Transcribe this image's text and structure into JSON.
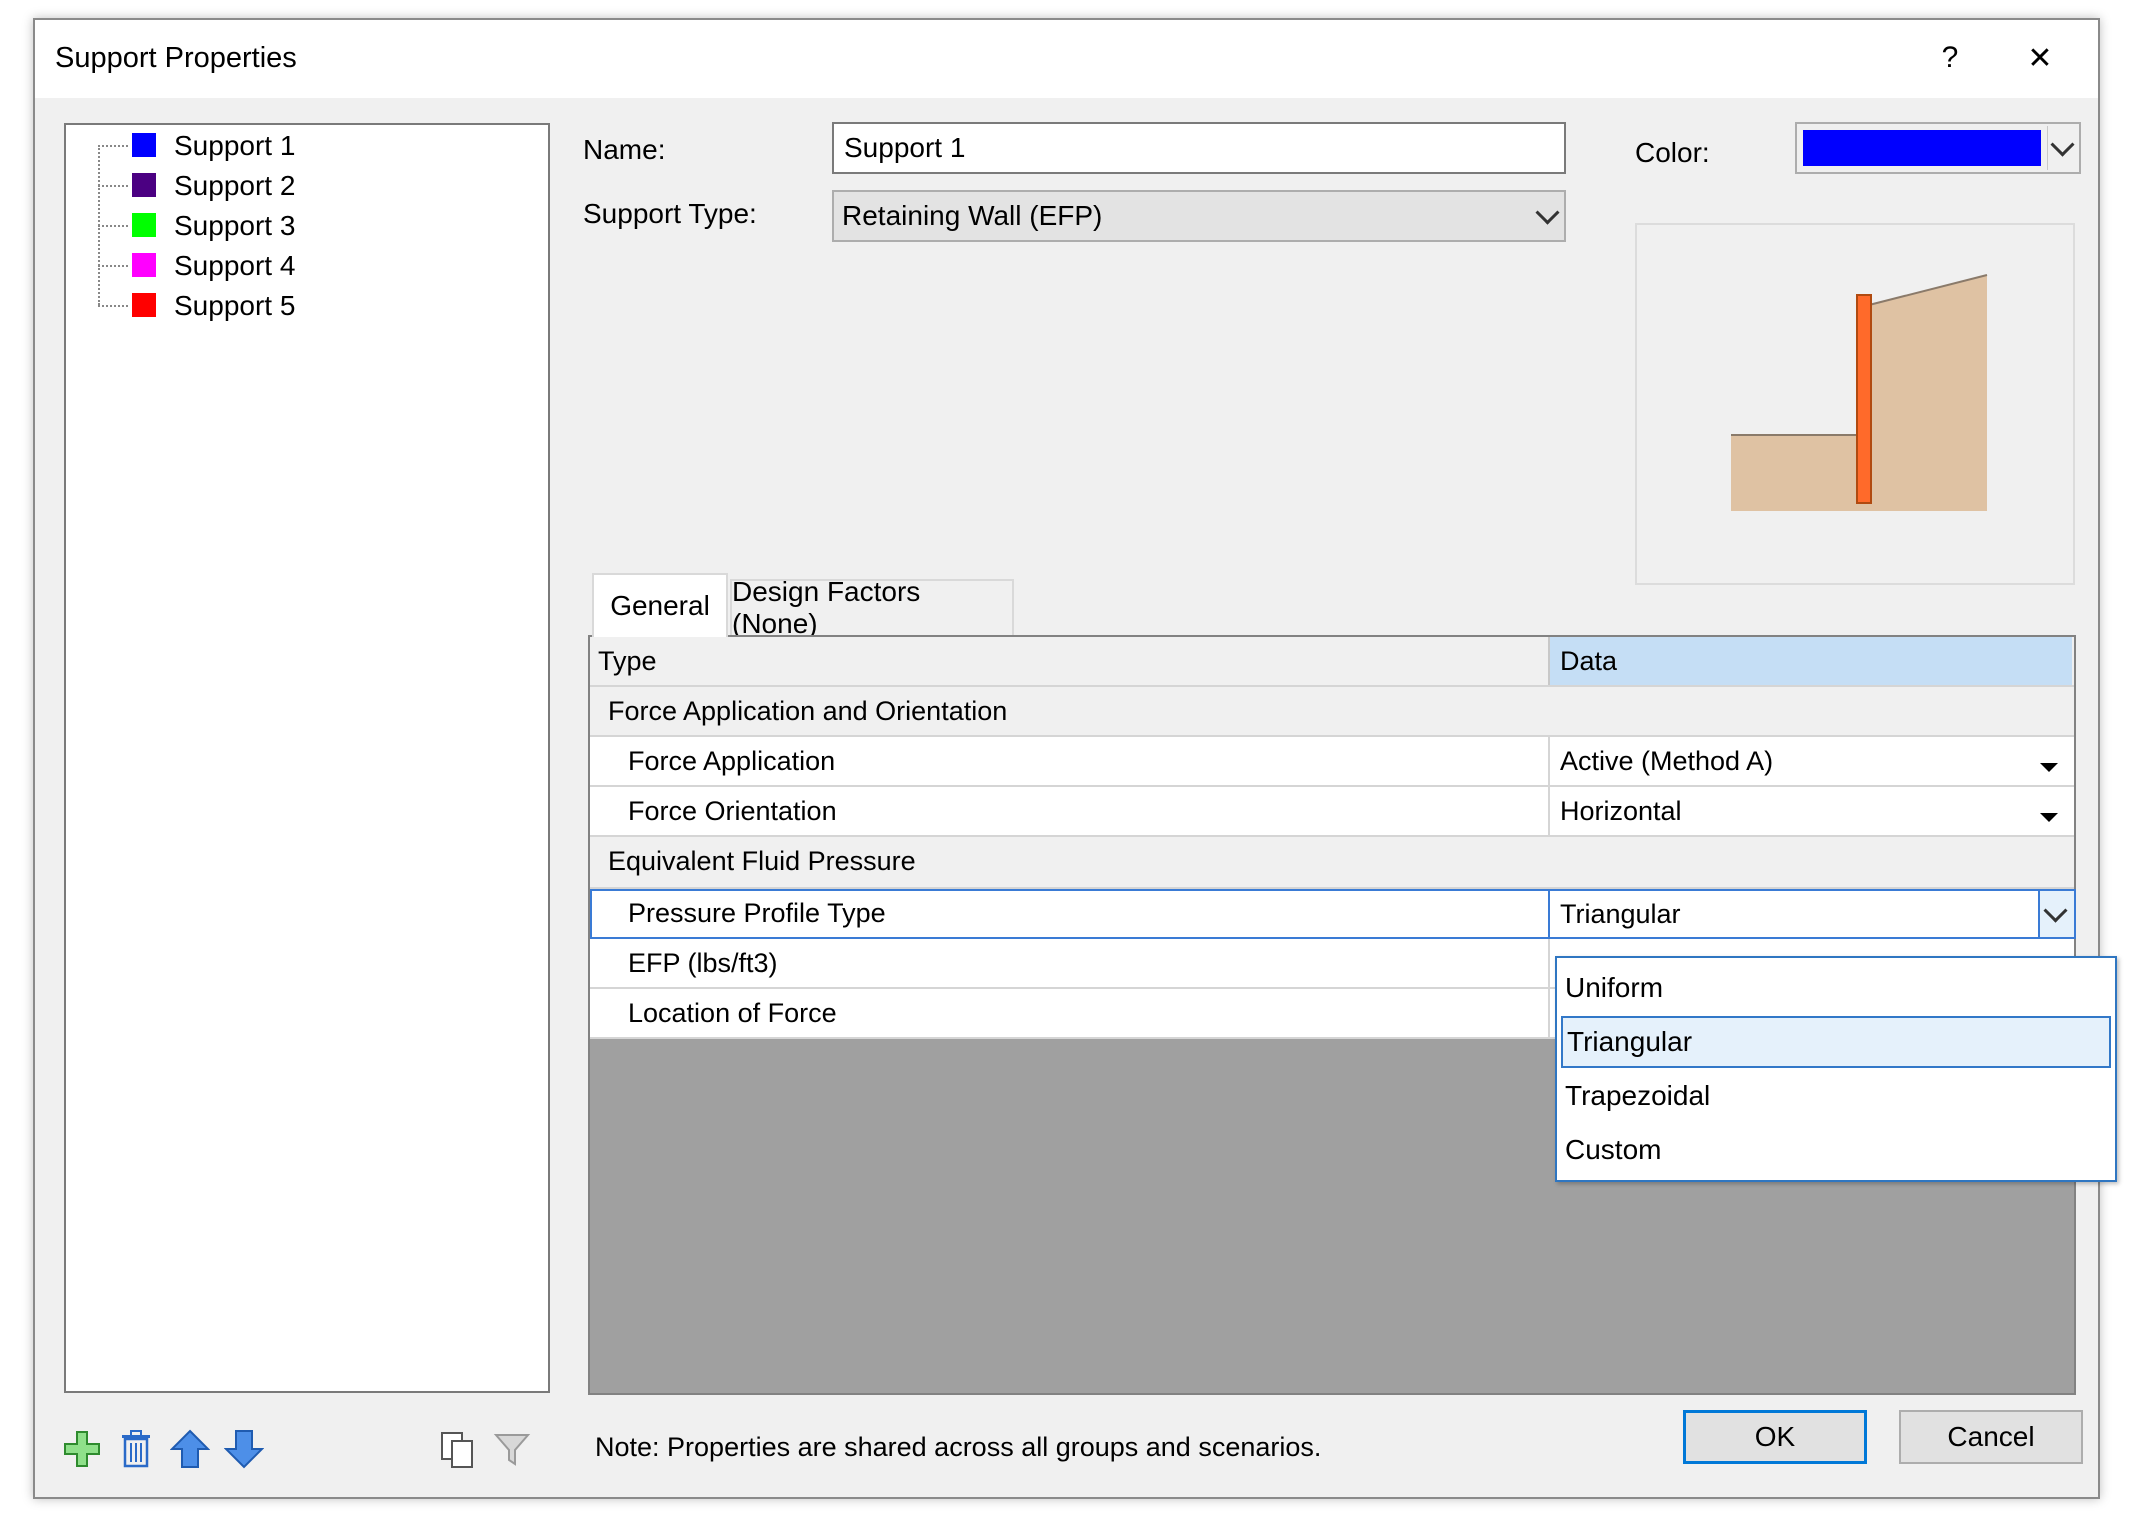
{
  "window": {
    "title": "Support Properties",
    "help_label": "?",
    "close_label": "✕"
  },
  "tree": {
    "items": [
      {
        "label": "Support 1",
        "color": "#0000ff"
      },
      {
        "label": "Support 2",
        "color": "#4b0082"
      },
      {
        "label": "Support 3",
        "color": "#00ff00"
      },
      {
        "label": "Support 4",
        "color": "#ff00ff"
      },
      {
        "label": "Support 5",
        "color": "#ff0000"
      }
    ]
  },
  "form": {
    "name_label": "Name:",
    "name_value": "Support 1",
    "type_label": "Support Type:",
    "type_value": "Retaining Wall (EFP)",
    "color_label": "Color:",
    "color_value": "#0000ff"
  },
  "tabs": [
    {
      "label": "General",
      "active": true
    },
    {
      "label": "Design Factors (None)",
      "active": false
    }
  ],
  "grid": {
    "headers": {
      "type": "Type",
      "data": "Data"
    },
    "section1": "Force Application and Orientation",
    "rows1": [
      {
        "type": "Force Application",
        "data": "Active (Method A)"
      },
      {
        "type": "Force Orientation",
        "data": "Horizontal"
      }
    ],
    "section2": "Equivalent Fluid Pressure",
    "rows2": [
      {
        "type": "Pressure Profile Type",
        "data": "Triangular"
      },
      {
        "type": "EFP (lbs/ft3)",
        "data": ""
      },
      {
        "type": "Location of Force",
        "data": ""
      }
    ]
  },
  "dropdown": {
    "options": [
      "Uniform",
      "Triangular",
      "Trapezoidal",
      "Custom"
    ],
    "selected": "Triangular"
  },
  "footer": {
    "note": "Note: Properties are shared across all groups and scenarios.",
    "ok_label": "OK",
    "cancel_label": "Cancel"
  }
}
